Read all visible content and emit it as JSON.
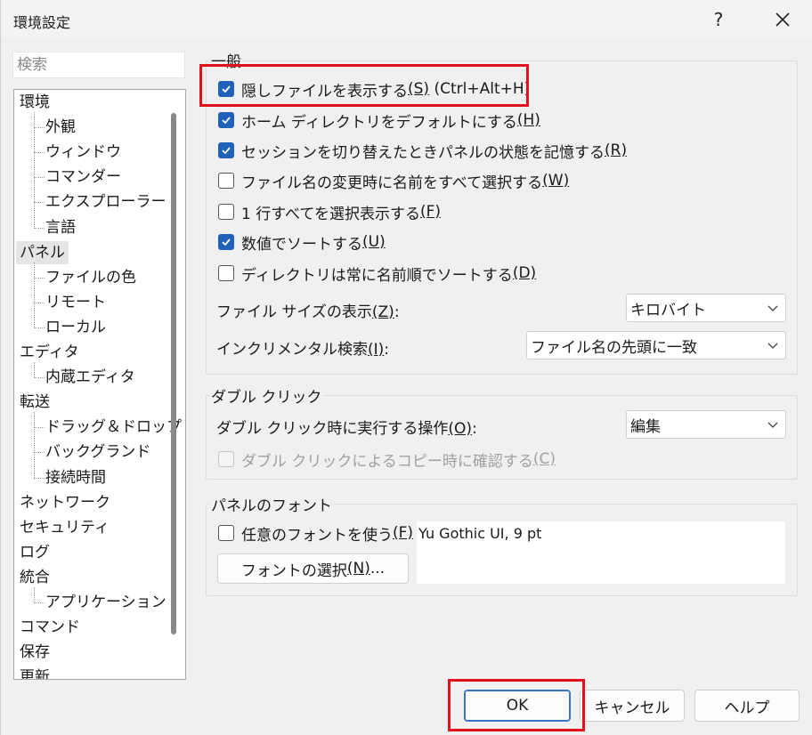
{
  "window": {
    "title": "環境設定",
    "help_glyph": "?",
    "close_icon": "close-icon"
  },
  "search": {
    "placeholder": "検索"
  },
  "tree": {
    "items": [
      {
        "label": "環境",
        "level": 0
      },
      {
        "label": "外観",
        "level": 1
      },
      {
        "label": "ウィンドウ",
        "level": 1
      },
      {
        "label": "コマンダー",
        "level": 1
      },
      {
        "label": "エクスプローラー",
        "level": 1
      },
      {
        "label": "言語",
        "level": 1
      },
      {
        "label": "パネル",
        "level": 0,
        "selected": true
      },
      {
        "label": "ファイルの色",
        "level": 1
      },
      {
        "label": "リモート",
        "level": 1
      },
      {
        "label": "ローカル",
        "level": 1
      },
      {
        "label": "エディタ",
        "level": 0
      },
      {
        "label": "内蔵エディタ",
        "level": 1
      },
      {
        "label": "転送",
        "level": 0
      },
      {
        "label": "ドラッグ＆ドロップ",
        "level": 1
      },
      {
        "label": "バックグランド",
        "level": 1
      },
      {
        "label": "接続時間",
        "level": 1
      },
      {
        "label": "ネットワーク",
        "level": 0
      },
      {
        "label": "セキュリティ",
        "level": 0
      },
      {
        "label": "ログ",
        "level": 0
      },
      {
        "label": "統合",
        "level": 0
      },
      {
        "label": "アプリケーション",
        "level": 1
      },
      {
        "label": "コマンド",
        "level": 0
      },
      {
        "label": "保存",
        "level": 0
      },
      {
        "label": "更新",
        "level": 0
      }
    ]
  },
  "general": {
    "title": "一般",
    "checkboxes": [
      {
        "text": "隠しファイルを表示する",
        "key": "(S)",
        "suffix": " (Ctrl+Alt+H)",
        "checked": true
      },
      {
        "text": "ホーム ディレクトリをデフォルトにする",
        "key": "(H)",
        "suffix": "",
        "checked": true
      },
      {
        "text": "セッションを切り替えたときパネルの状態を記憶する",
        "key": "(R)",
        "suffix": "",
        "checked": true
      },
      {
        "text": "ファイル名の変更時に名前をすべて選択する",
        "key": "(W)",
        "suffix": "",
        "checked": false
      },
      {
        "text": "1 行すべてを選択表示する",
        "key": "(F)",
        "suffix": "",
        "checked": false
      },
      {
        "text": "数値でソートする",
        "key": "(U)",
        "suffix": "",
        "checked": true
      },
      {
        "text": "ディレクトリは常に名前順でソートする",
        "key": "(D)",
        "suffix": "",
        "checked": false
      }
    ],
    "filesize_label": "ファイル サイズの表示",
    "filesize_key": "(Z)",
    "filesize_colon": ":",
    "filesize_value": "キロバイト",
    "incremental_label": "インクリメンタル検索",
    "incremental_key": "(I)",
    "incremental_colon": ":",
    "incremental_value": "ファイル名の先頭に一致"
  },
  "doubleclick": {
    "title": "ダブル クリック",
    "action_label": "ダブル クリック時に実行する操作",
    "action_key": "(O)",
    "action_colon": ":",
    "action_value": "編集",
    "confirm_text": "ダブル クリックによるコピー時に確認する",
    "confirm_key": "(C)"
  },
  "panelfont": {
    "title": "パネルのフォント",
    "custom_text": "任意のフォントを使う",
    "custom_key": "(F)",
    "select_button": "フォントの選択",
    "select_key": "(N)",
    "select_ellipsis": "...",
    "preview": "Yu Gothic UI, 9 pt"
  },
  "footer": {
    "ok": "OK",
    "cancel": "キャンセル",
    "help": "ヘルプ"
  },
  "colors": {
    "highlight": "#e0101e",
    "checkbox_checked": "#1f62b8"
  }
}
